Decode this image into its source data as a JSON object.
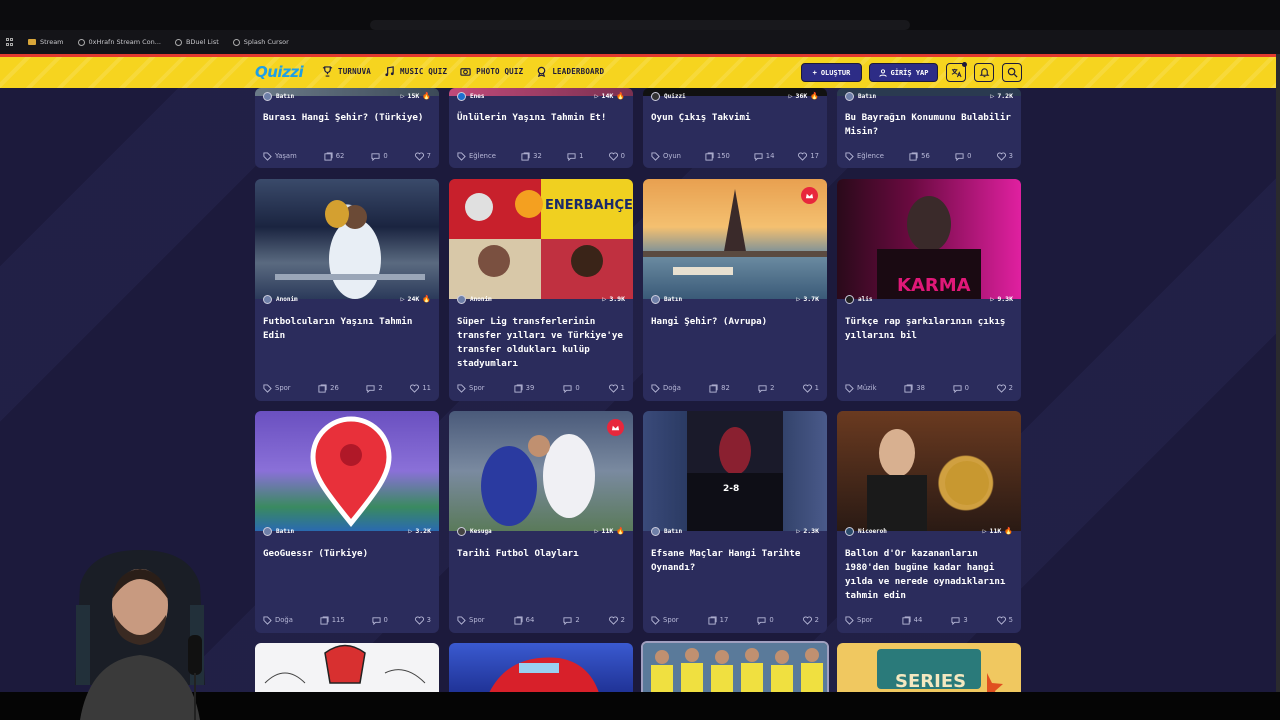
{
  "bookmarks": [
    "Stream",
    "0xHrafn Stream Con...",
    "BDuel List",
    "Splash Cursor"
  ],
  "nav": {
    "logo": "Quizzi",
    "items": [
      "TURNUVA",
      "MUSIC QUIZ",
      "PHOTO QUIZ",
      "LEADERBOARD"
    ],
    "create_label": "OLUŞTUR",
    "login_label": "GİRİŞ YAP"
  },
  "colors": {
    "nav_yellow": "#f6d41f",
    "page_bg": "#1c1a3c",
    "card_bg": "#2b2c5c",
    "button_blue": "#2d2c86",
    "crown_red": "#e8273c",
    "fire": "#ff6a2a"
  },
  "cards": [
    {
      "author": "Batın",
      "plays": "15K",
      "fire": true,
      "title": "Burası Hangi Şehir? (Türkiye)",
      "category": "Yaşam",
      "questions": "62",
      "comments": "0",
      "likes": "7"
    },
    {
      "author": "Enes",
      "plays": "14K",
      "fire": true,
      "title": "Ünlülerin Yaşını Tahmin Et!",
      "category": "Eğlence",
      "questions": "32",
      "comments": "1",
      "likes": "0"
    },
    {
      "author": "Quizzi",
      "plays": "36K",
      "fire": true,
      "title": "Oyun Çıkış Takvimi",
      "category": "Oyun",
      "questions": "150",
      "comments": "14",
      "likes": "17"
    },
    {
      "author": "Batın",
      "plays": "7.2K",
      "fire": false,
      "title": "Bu Bayrağın Konumunu Bulabilir Misin?",
      "category": "Eğlence",
      "questions": "56",
      "comments": "0",
      "likes": "3"
    },
    {
      "author": "Anonim",
      "plays": "24K",
      "fire": true,
      "title": "Futbolcuların Yaşını Tahmin Edin",
      "category": "Spor",
      "questions": "26",
      "comments": "2",
      "likes": "11"
    },
    {
      "author": "Anonim",
      "plays": "3.9K",
      "fire": false,
      "title": "Süper Lig transferlerinin transfer yılları ve Türkiye'ye transfer oldukları kulüp stadyumları",
      "category": "Spor",
      "questions": "39",
      "comments": "0",
      "likes": "1"
    },
    {
      "author": "Batın",
      "plays": "3.7K",
      "fire": false,
      "title": "Hangi Şehir? (Avrupa)",
      "category": "Doğa",
      "questions": "82",
      "comments": "2",
      "likes": "1"
    },
    {
      "author": "alis",
      "plays": "9.3K",
      "fire": false,
      "title": "Türkçe rap şarkılarının çıkış yıllarını bil",
      "category": "Müzik",
      "questions": "38",
      "comments": "0",
      "likes": "2"
    },
    {
      "author": "Batın",
      "plays": "3.2K",
      "fire": false,
      "title": "GeoGuessr (Türkiye)",
      "category": "Doğa",
      "questions": "115",
      "comments": "0",
      "likes": "3"
    },
    {
      "author": "Kesuga",
      "plays": "11K",
      "fire": true,
      "title": "Tarihi Futbol Olayları",
      "category": "Spor",
      "questions": "64",
      "comments": "2",
      "likes": "2"
    },
    {
      "author": "Batın",
      "plays": "2.3K",
      "fire": false,
      "title": "Efsane Maçlar Hangi Tarihte Oynandı?",
      "category": "Spor",
      "questions": "17",
      "comments": "0",
      "likes": "2"
    },
    {
      "author": "Nicoeroh",
      "plays": "11K",
      "fire": true,
      "title": "Ballon d'Or kazananların 1980'den bugüne kadar hangi yılda ve nerede oynadıklarını tahmin edin",
      "category": "Spor",
      "questions": "44",
      "comments": "3",
      "likes": "5"
    }
  ],
  "bottom_card_texts": {
    "kar_series": "SERIES"
  }
}
